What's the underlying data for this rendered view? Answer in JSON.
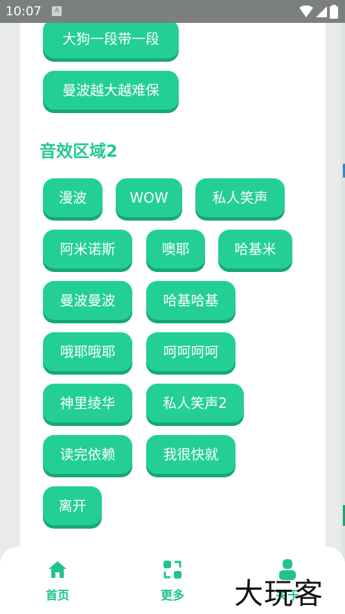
{
  "status_bar": {
    "time": "10:07",
    "notification_icon": "A"
  },
  "partial_top_button": {
    "label": ""
  },
  "section1_buttons": [
    {
      "label": "大狗一段带一段"
    },
    {
      "label": "曼波越大越难保"
    }
  ],
  "section2": {
    "title": "音效区域2",
    "buttons": [
      {
        "label": "漫波"
      },
      {
        "label": "WOW"
      },
      {
        "label": "私人笑声"
      },
      {
        "label": "阿米诺斯"
      },
      {
        "label": "噢耶"
      },
      {
        "label": "哈基米"
      },
      {
        "label": "曼波曼波"
      },
      {
        "label": "哈基哈基"
      },
      {
        "label": "哦耶哦耶"
      },
      {
        "label": "呵呵呵呵"
      },
      {
        "label": "神里绫华"
      },
      {
        "label": "私人笑声2"
      },
      {
        "label": "读完依赖"
      },
      {
        "label": "我很快就"
      },
      {
        "label": "离开"
      }
    ]
  },
  "bottom_nav": {
    "items": [
      {
        "label": "首页",
        "icon": "home-icon"
      },
      {
        "label": "更多",
        "icon": "swap-icon"
      },
      {
        "label": "关于",
        "icon": "person-icon"
      }
    ]
  },
  "watermark": "大玩客",
  "colors": {
    "accent": "#23cf95",
    "accent_shadow": "#15a876",
    "title": "#22c994"
  }
}
